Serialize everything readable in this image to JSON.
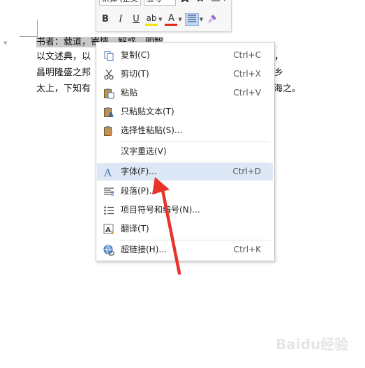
{
  "toolbar": {
    "font_name": "宋体 (正文",
    "font_size": "五号",
    "grow_font": "A",
    "shrink_font": "A",
    "bold": "B",
    "italic": "I",
    "underline": "U",
    "highlight": "ab",
    "font_color": "A",
    "highlight_color": "#f2e400",
    "font_color_value": "#e0261b"
  },
  "document": {
    "line1_selected": "书者：载道，寄情，解惑，明智",
    "line2_start": "以文述典，以",
    "line2_end": "，",
    "line3_start": "昌明隆盛之邦",
    "line3_end": "乡",
    "line4_start": "太上，下知有",
    "line4_end": "海之。"
  },
  "context_menu": {
    "items": [
      {
        "label": "复制(C)",
        "shortcut": "Ctrl+C"
      },
      {
        "label": "剪切(T)",
        "shortcut": "Ctrl+X"
      },
      {
        "label": "粘贴",
        "shortcut": "Ctrl+V"
      },
      {
        "label": "只粘贴文本(T)",
        "shortcut": ""
      },
      {
        "label": "选择性粘贴(S)...",
        "shortcut": ""
      },
      {
        "label": "汉字重选(V)",
        "shortcut": ""
      },
      {
        "label": "字体(F)...",
        "shortcut": "Ctrl+D",
        "highlighted": true
      },
      {
        "label": "段落(P)...",
        "shortcut": ""
      },
      {
        "label": "项目符号和编号(N)...",
        "shortcut": ""
      },
      {
        "label": "翻译(T)",
        "shortcut": ""
      },
      {
        "label": "超链接(H)...",
        "shortcut": "Ctrl+K"
      }
    ]
  },
  "colors": {
    "menu_highlight": "#dde8f6",
    "annotation_arrow": "#e8332a",
    "selection": "#c9c9c9"
  },
  "watermark": "Baidu经验"
}
